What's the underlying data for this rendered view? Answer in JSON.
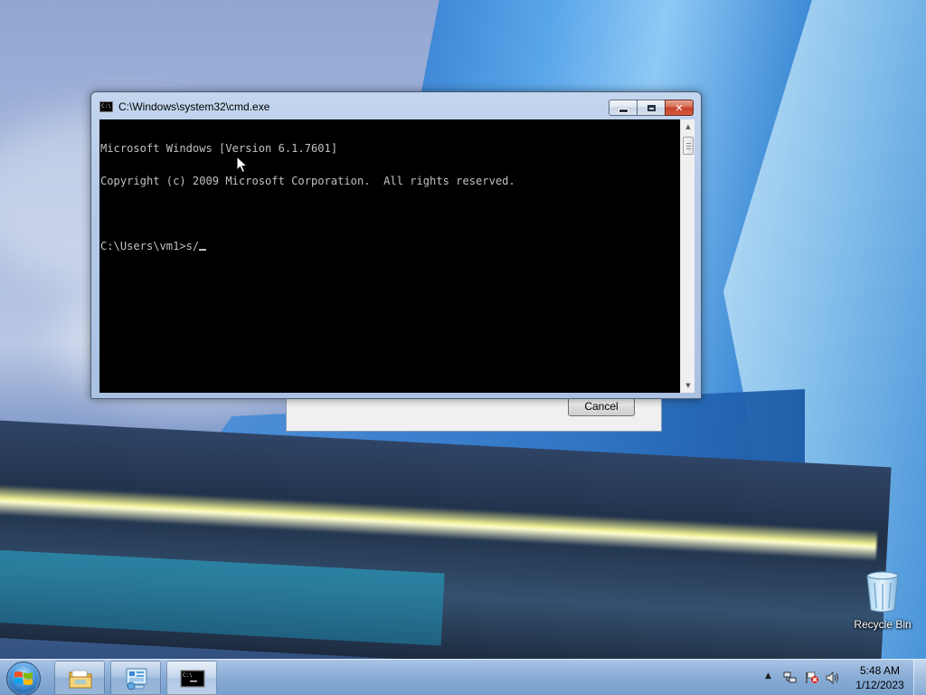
{
  "cmd_window": {
    "title": "C:\\Windows\\system32\\cmd.exe",
    "icon_text": "C:\\",
    "console_lines": [
      "Microsoft Windows [Version 6.1.7601]",
      "Copyright (c) 2009 Microsoft Corporation.  All rights reserved.",
      "",
      "C:\\Users\\vm1>s/"
    ]
  },
  "background_dialog": {
    "cancel_label": "Cancel"
  },
  "desktop": {
    "recycle_bin_label": "Recycle Bin"
  },
  "taskbar": {
    "items": [
      {
        "name": "Windows Explorer",
        "icon": "folder-icon"
      },
      {
        "name": "Control Panel",
        "icon": "control-panel-icon"
      },
      {
        "name": "Command Prompt",
        "icon": "cmd-icon",
        "active": true
      }
    ],
    "tray_icons": [
      "show-hidden-icons",
      "network-icon",
      "action-center-flag-icon",
      "volume-icon"
    ],
    "clock_time": "5:48 AM",
    "clock_date": "1/12/2023"
  },
  "colors": {
    "console_bg": "#000000",
    "console_fg": "#c0c0c0",
    "window_frame": "#b6cbe8",
    "close_button": "#c4412a"
  }
}
